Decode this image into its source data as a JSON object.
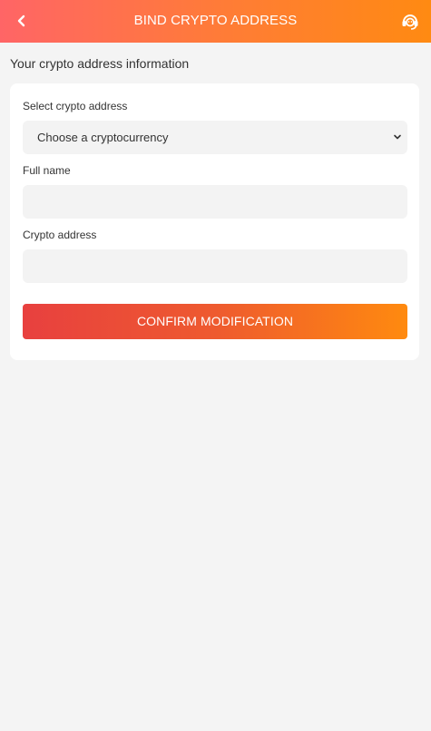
{
  "header": {
    "title": "BIND CRYPTO ADDRESS",
    "back_icon": "chevron-left-icon",
    "support_icon": "customer-service-icon",
    "gradient_start": "#ff6566",
    "gradient_end": "#ff8a12"
  },
  "section": {
    "title": "Your crypto address information"
  },
  "form": {
    "crypto_select": {
      "label": "Select crypto address",
      "selected": "Choose a cryptocurrency"
    },
    "full_name": {
      "label": "Full name",
      "value": "",
      "placeholder": ""
    },
    "crypto_address": {
      "label": "Crypto address",
      "value": "",
      "placeholder": ""
    },
    "confirm_label": "CONFIRM MODIFICATION"
  },
  "colors": {
    "page_bg": "#f4f4f4",
    "card_bg": "#ffffff",
    "input_bg": "#f3f3f3",
    "button_gradient_start": "#e8403f",
    "button_gradient_end": "#ff8a0f"
  }
}
